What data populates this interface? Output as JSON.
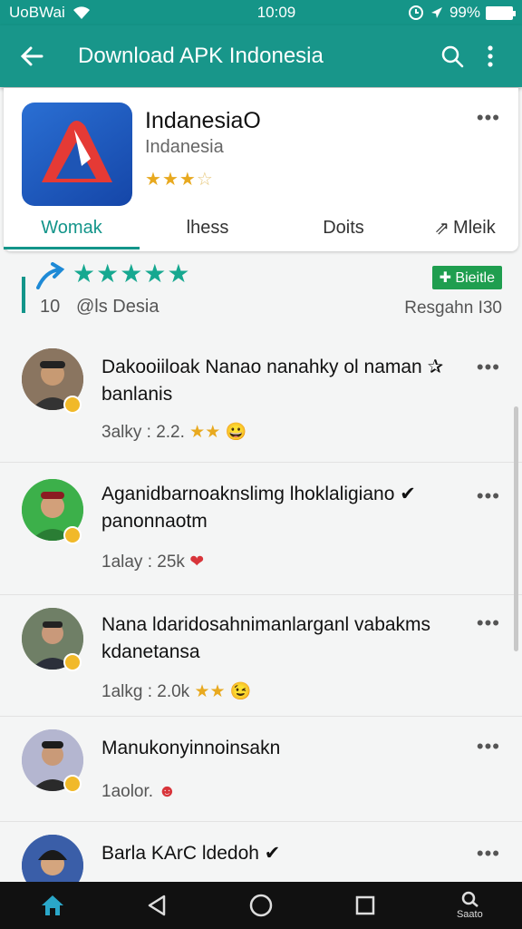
{
  "status_bar": {
    "carrier": "UoBWai",
    "time": "10:09",
    "battery": "99%",
    "battery_level": 0.99
  },
  "app_bar": {
    "title": "Download APK Indonesia"
  },
  "app": {
    "name": "IndanesiaO",
    "developer": "Indanesia",
    "rating_stars": 3.5,
    "tabs": [
      "Womak",
      "lhess",
      "Doits",
      "Mleik"
    ],
    "active_tab": 0
  },
  "rating_summary": {
    "stars": 5,
    "count": "10",
    "by": "@ls Desia",
    "badge": "Bieitle",
    "response": "Resgahn I30"
  },
  "reviews": [
    {
      "text": "Dakooiiloak Nanao nanahky ol naman ✰ banlanis",
      "meta": "3alky : 2.2.",
      "stars": "★★",
      "emoji": "😀"
    },
    {
      "text": "Aganidbarnoaknslimg lhoklaligiano ✔ panonnaotm",
      "meta": "1alay : 25k",
      "stars": "",
      "emoji": "❤"
    },
    {
      "text": "Nana ldaridosahnimanlarganl vabakms kdanetansa",
      "meta": "1alkg : 2.0k",
      "stars": "★★",
      "emoji": "😉"
    },
    {
      "text": "Manukonyinnoinsakn",
      "meta": "1aolor.",
      "stars": "",
      "emoji": "☻"
    },
    {
      "text": "Barla KArC ldedoh ✔",
      "meta": "",
      "stars": "",
      "emoji": ""
    }
  ],
  "nav_bar": {
    "search_label": "Saato"
  },
  "colors": {
    "primary": "#18968a",
    "accent": "#13958a",
    "star": "#e8a91f"
  }
}
